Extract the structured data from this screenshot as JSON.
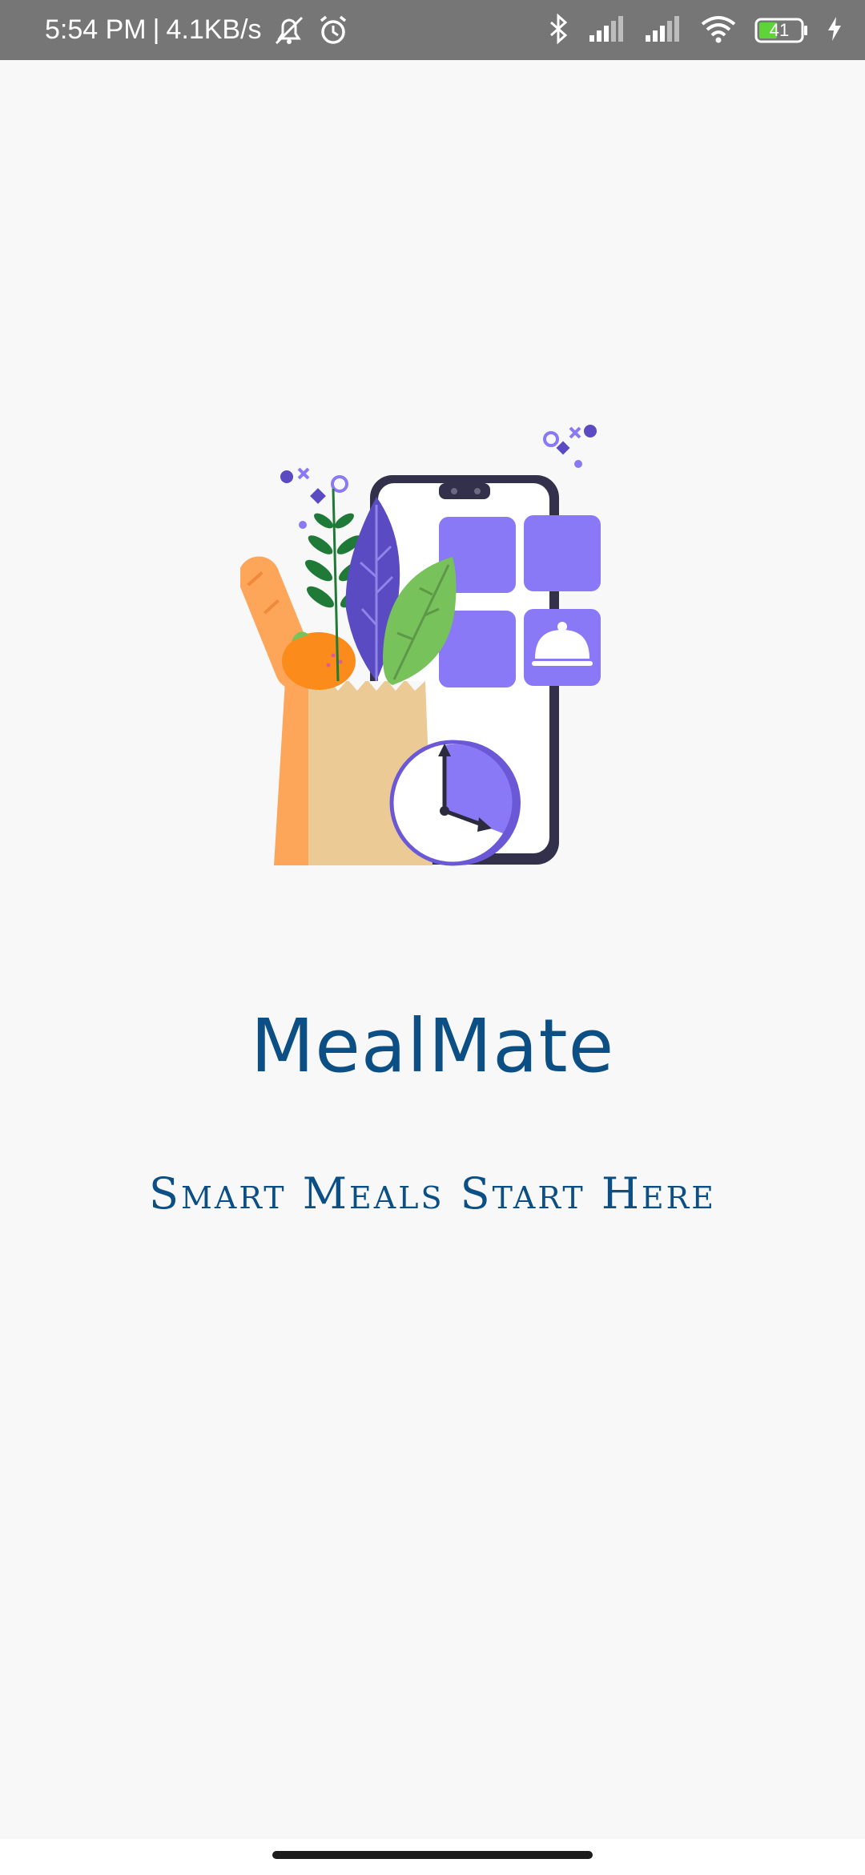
{
  "status_bar": {
    "time": "5:54 PM",
    "separator": "|",
    "network_speed": "4.1KB/s",
    "battery_level": "41",
    "icons": [
      "notifications-muted-icon",
      "alarm-icon",
      "bluetooth-icon",
      "signal-icon",
      "signal-icon",
      "wifi-icon",
      "battery-icon",
      "charging-icon"
    ]
  },
  "splash": {
    "title": "MealMate",
    "tagline": "Smart Meals Start Here",
    "colors": {
      "brand_text": "#0c4f85",
      "accent_purple": "#8979f7",
      "background": "#f8f8f8"
    }
  }
}
